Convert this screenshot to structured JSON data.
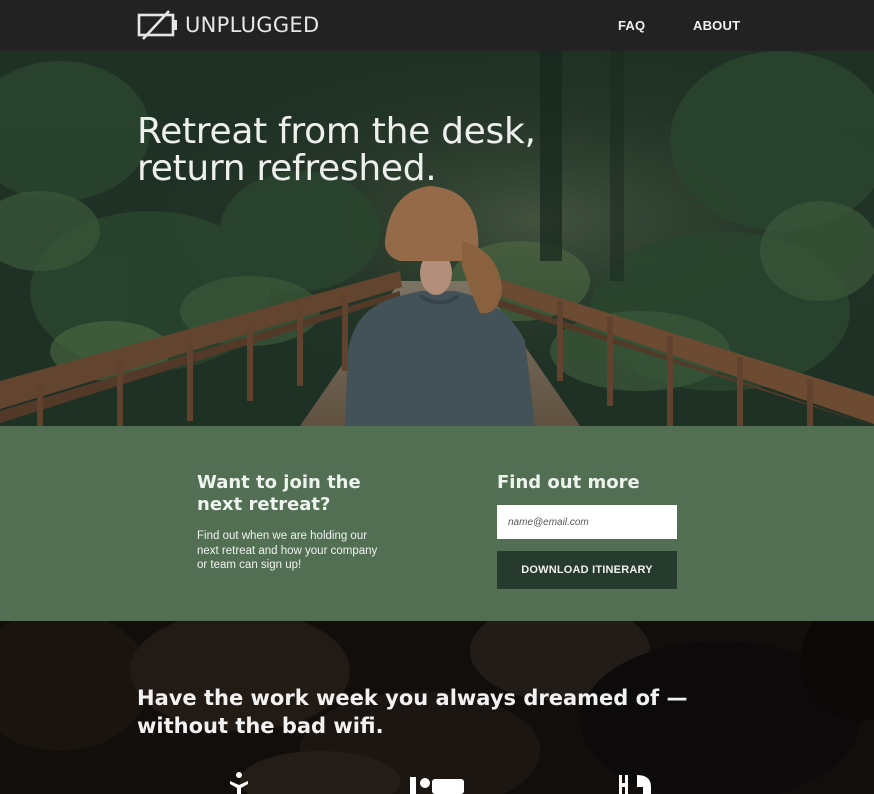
{
  "nav": {
    "logo_text": "UNPLUGGED",
    "links": [
      {
        "label": "FAQ"
      },
      {
        "label": "ABOUT"
      }
    ]
  },
  "hero": {
    "title_line1": "Retreat from the desk,",
    "title_line2": "return refreshed."
  },
  "cta": {
    "left_title_line1": "Want to join the",
    "left_title_line2": "next retreat?",
    "description": "Find out when we are holding our next retreat and how your company or team can sign up!",
    "right_title": "Find out more",
    "email_placeholder": "name@email.com",
    "email_value": "",
    "button_label": "DOWNLOAD ITINERARY"
  },
  "bottom": {
    "title_line1": "Have the work week you always dreamed of —",
    "title_line2": "without the bad wifi.",
    "feature_icons": [
      "yoga-icon",
      "bed-icon",
      "utensils-icon"
    ]
  },
  "colors": {
    "nav_bg": "#222222",
    "cta_bg": "#526f54",
    "button_bg": "#263a2d"
  }
}
